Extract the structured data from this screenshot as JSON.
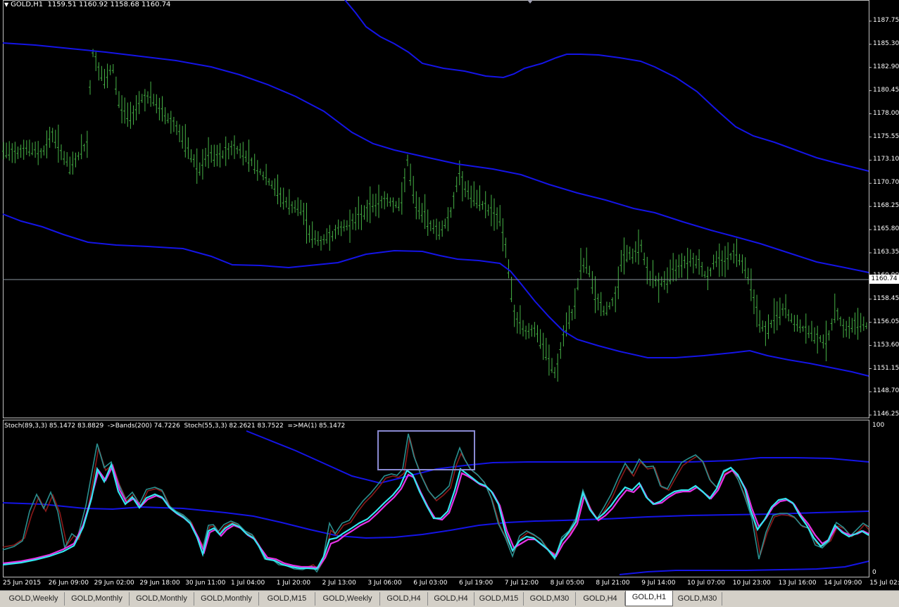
{
  "main": {
    "header": "GOLD,H1  1159.51 1160.92 1158.68 1160.74",
    "price_labels": [
      "1187.75",
      "1185.30",
      "1182.90",
      "1180.45",
      "1178.00",
      "1175.55",
      "1173.10",
      "1170.70",
      "1168.25",
      "1165.80",
      "1163.35",
      "1160.90",
      "1158.45",
      "1156.05",
      "1153.60",
      "1151.15",
      "1148.70",
      "1146.25"
    ],
    "current_price": "1160.74"
  },
  "stoch": {
    "header": "Stoch(89,3,3) 85.1472 83.8829  ->Bands(200) 74.7226  Stoch(55,3,3) 82.2621 83.7522  =>MA(1) 85.1472",
    "scale_top": "100",
    "scale_bottom": "0"
  },
  "time_labels": [
    "25 Jun 2015",
    "26 Jun 09:00",
    "29 Jun 02:00",
    "29 Jun 18:00",
    "30 Jun 11:00",
    "1 Jul 04:00",
    "1 Jul 20:00",
    "2 Jul 13:00",
    "3 Jul 06:00",
    "6 Jul 03:00",
    "6 Jul 19:00",
    "7 Jul 12:00",
    "8 Jul 05:00",
    "8 Jul 21:00",
    "9 Jul 14:00",
    "10 Jul 07:00",
    "10 Jul 23:00",
    "13 Jul 16:00",
    "14 Jul 09:00",
    "15 Jul 02:00"
  ],
  "tabs": [
    {
      "label": "GOLD,Weekly",
      "active": false
    },
    {
      "label": "GOLD,Monthly",
      "active": false
    },
    {
      "label": "GOLD,Monthly",
      "active": false
    },
    {
      "label": "GOLD,Monthly",
      "active": false
    },
    {
      "label": "GOLD,M15",
      "active": false
    },
    {
      "label": "GOLD,Weekly",
      "active": false
    },
    {
      "label": "GOLD,H4",
      "active": false
    },
    {
      "label": "GOLD,H4",
      "active": false
    },
    {
      "label": "GOLD,M15",
      "active": false
    },
    {
      "label": "GOLD,M30",
      "active": false
    },
    {
      "label": "GOLD,H4",
      "active": false
    },
    {
      "label": "GOLD,H1",
      "active": true
    },
    {
      "label": "GOLD,M30",
      "active": false
    }
  ],
  "colors": {
    "candles": "#46b246",
    "bands": "#1414e6",
    "stoch_fast": "#2a8f8f",
    "stoch_fast_signal": "#8b1a1a",
    "stoch_slow": "#33e6f0",
    "stoch_slow_signal": "#e633e6",
    "highlight_box": "#8a8ad2",
    "price_line": "#8c96a0"
  }
}
